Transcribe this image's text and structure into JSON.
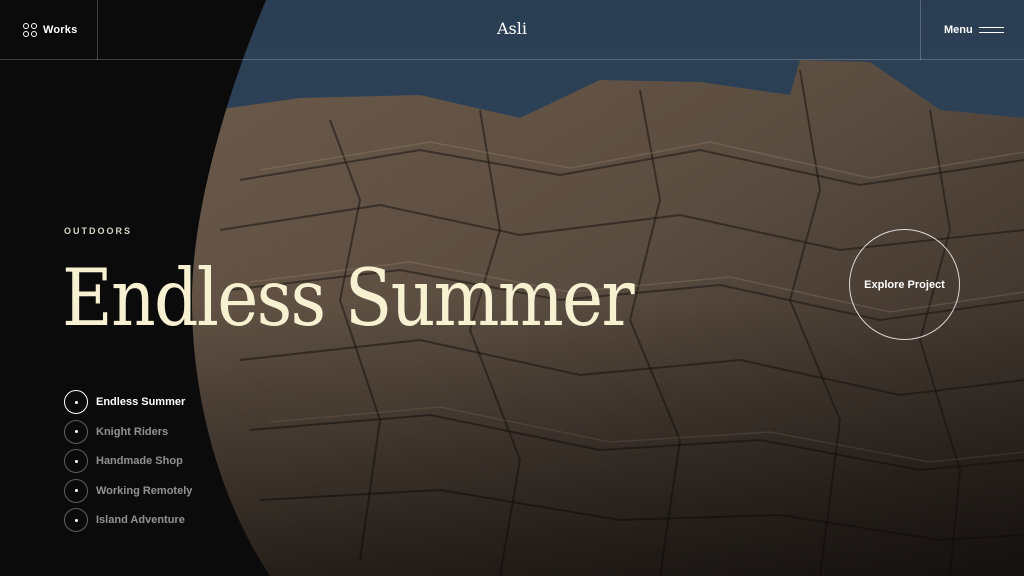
{
  "header": {
    "works_label": "Works",
    "works_icon": "grid-icon",
    "logo": "Asli",
    "menu_label": "Menu",
    "menu_icon": "hamburger-icon"
  },
  "hero": {
    "category": "OUTDOORS",
    "title": "Endless Summer",
    "explore_label": "Explore Project",
    "background_image": "rocky coastal cliff under dark blue sky"
  },
  "projects": [
    {
      "label": "Endless Summer",
      "active": true
    },
    {
      "label": "Knight Riders",
      "active": false
    },
    {
      "label": "Handmade Shop",
      "active": false
    },
    {
      "label": "Working Remotely",
      "active": false
    },
    {
      "label": "Island Adventure",
      "active": false
    }
  ],
  "colors": {
    "panel": "#0b0b0b",
    "title": "#f7f1d2",
    "sky": "#2f4457",
    "rock": "#5e5044"
  }
}
